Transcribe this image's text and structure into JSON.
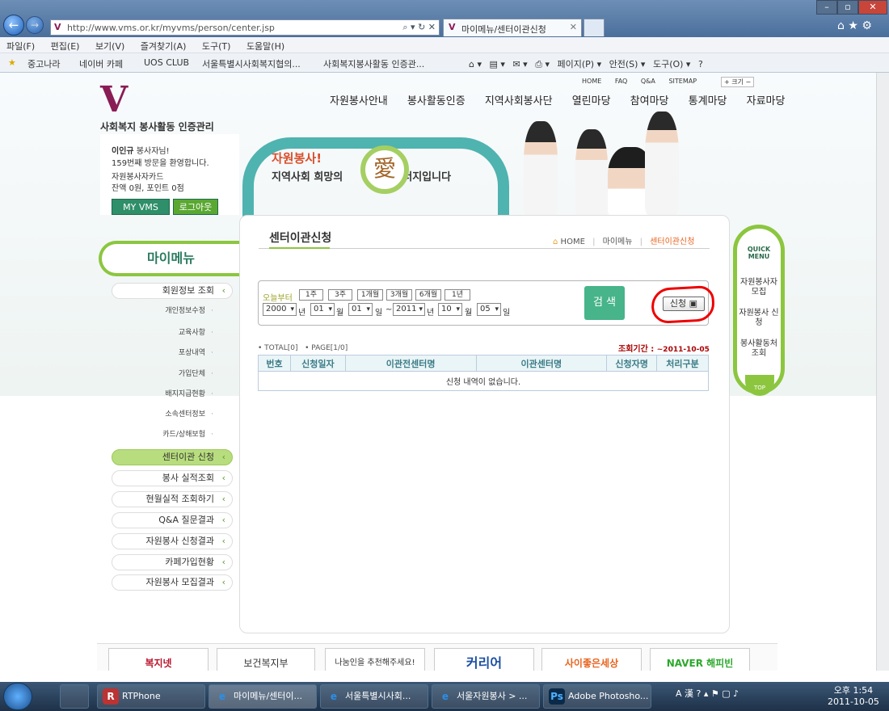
{
  "browser": {
    "url": "http://www.vms.or.kr/myvms/person/center.jsp",
    "tabs": [
      {
        "label": "마이메뉴/센터이관신청"
      }
    ],
    "menu": [
      "파일(F)",
      "편집(E)",
      "보기(V)",
      "즐겨찾기(A)",
      "도구(T)",
      "도움말(H)"
    ],
    "favorites": [
      "중고나라",
      "네이버 카페",
      "UOS CLUB",
      "서울특별시사회복지협의...",
      "사회복지봉사활동 인증관..."
    ],
    "commands": [
      "페이지(P) ▾",
      "안전(S) ▾",
      "도구(O) ▾"
    ]
  },
  "site": {
    "logo_letter": "V",
    "logo_text": "사회복지 봉사활동 인증관리",
    "top_links": [
      "HOME",
      "FAQ",
      "Q&A",
      "SITEMAP"
    ],
    "zoom_label": "+ 크기 −",
    "nav": [
      "자원봉사안내",
      "봉사활동인증",
      "지역사회봉사단",
      "열린마당",
      "참여마당",
      "통계마당",
      "자료마당"
    ],
    "banner": {
      "slogan1": "자원봉사!",
      "slogan2": "지역사회 희망의",
      "slogan3": "너지입니다",
      "heart_char": "愛"
    }
  },
  "user": {
    "name": "이인규",
    "suffix": "봉사자님!",
    "visit": "159번째 방문을 환영합니다.",
    "card": "자원봉사자카드",
    "balance": "잔액 0원, 포인트 0점",
    "myvms_label": "MY VMS",
    "logout_label": "로그아웃"
  },
  "left_menu": {
    "title": "마이메뉴",
    "top_item": "회원정보 조회",
    "sub_items": [
      "개인정보수정",
      "교육사항",
      "포상내역",
      "가입단체",
      "배지지급현황",
      "소속센터정보",
      "카드/상해보험"
    ],
    "items": [
      "센터이관 신청",
      "봉사 실적조회",
      "현월실적 조회하기",
      "Q&A 질문결과",
      "자원봉사 신청결과",
      "카페가입현황",
      "자원봉사 모집결과"
    ]
  },
  "content": {
    "title": "센터이관신청",
    "breadcrumb": {
      "home": "HOME",
      "sep": "|",
      "mid": "마이메뉴",
      "current": "센터이관신청"
    },
    "search": {
      "today_label": "오늘부터",
      "periods": [
        "1주",
        "3주",
        "1개월",
        "3개월",
        "6개월",
        "1년"
      ],
      "from_year": "2000",
      "from_month": "01",
      "from_day": "01",
      "to_year": "2011",
      "to_month": "10",
      "to_day": "05",
      "unit_year": "년",
      "unit_month": "월",
      "unit_day": "일",
      "tilde": "~",
      "search_label": "검 색",
      "apply_label": "신청"
    },
    "total": "• TOTAL[0]",
    "page": "• PAGE[1/0]",
    "period_label": "조회기간 :",
    "period_value": "~2011-10-05",
    "table": {
      "headers": [
        "번호",
        "신청일자",
        "이관전센터명",
        "이관센터명",
        "신청자명",
        "처리구분"
      ],
      "empty": "신청 내역이 없습니다."
    }
  },
  "quick_menu": {
    "title": "QUICK MENU",
    "items": [
      "자원봉사자 모집",
      "자원봉사 신청",
      "봉사활동처 조회"
    ],
    "top": "TOP"
  },
  "footer_links": [
    "복지넷",
    "보건복지부",
    "나눔인을 추천해주세요!",
    "커리어",
    "사이좋은세상",
    "NAVER 해피빈"
  ],
  "taskbar": {
    "items": [
      "RTPhone",
      "마이메뉴/센터이...",
      "서울특별시사회...",
      "서울자원봉사 > ...",
      "Adobe Photosho..."
    ],
    "tray_lang": "A 漢",
    "time": "오후 1:54",
    "date": "2011-10-05"
  },
  "colors": {
    "accent_green": "#8cc63f",
    "brand_teal": "#47b48a",
    "logo": "#8a1c55",
    "highlight": "#e00000"
  }
}
